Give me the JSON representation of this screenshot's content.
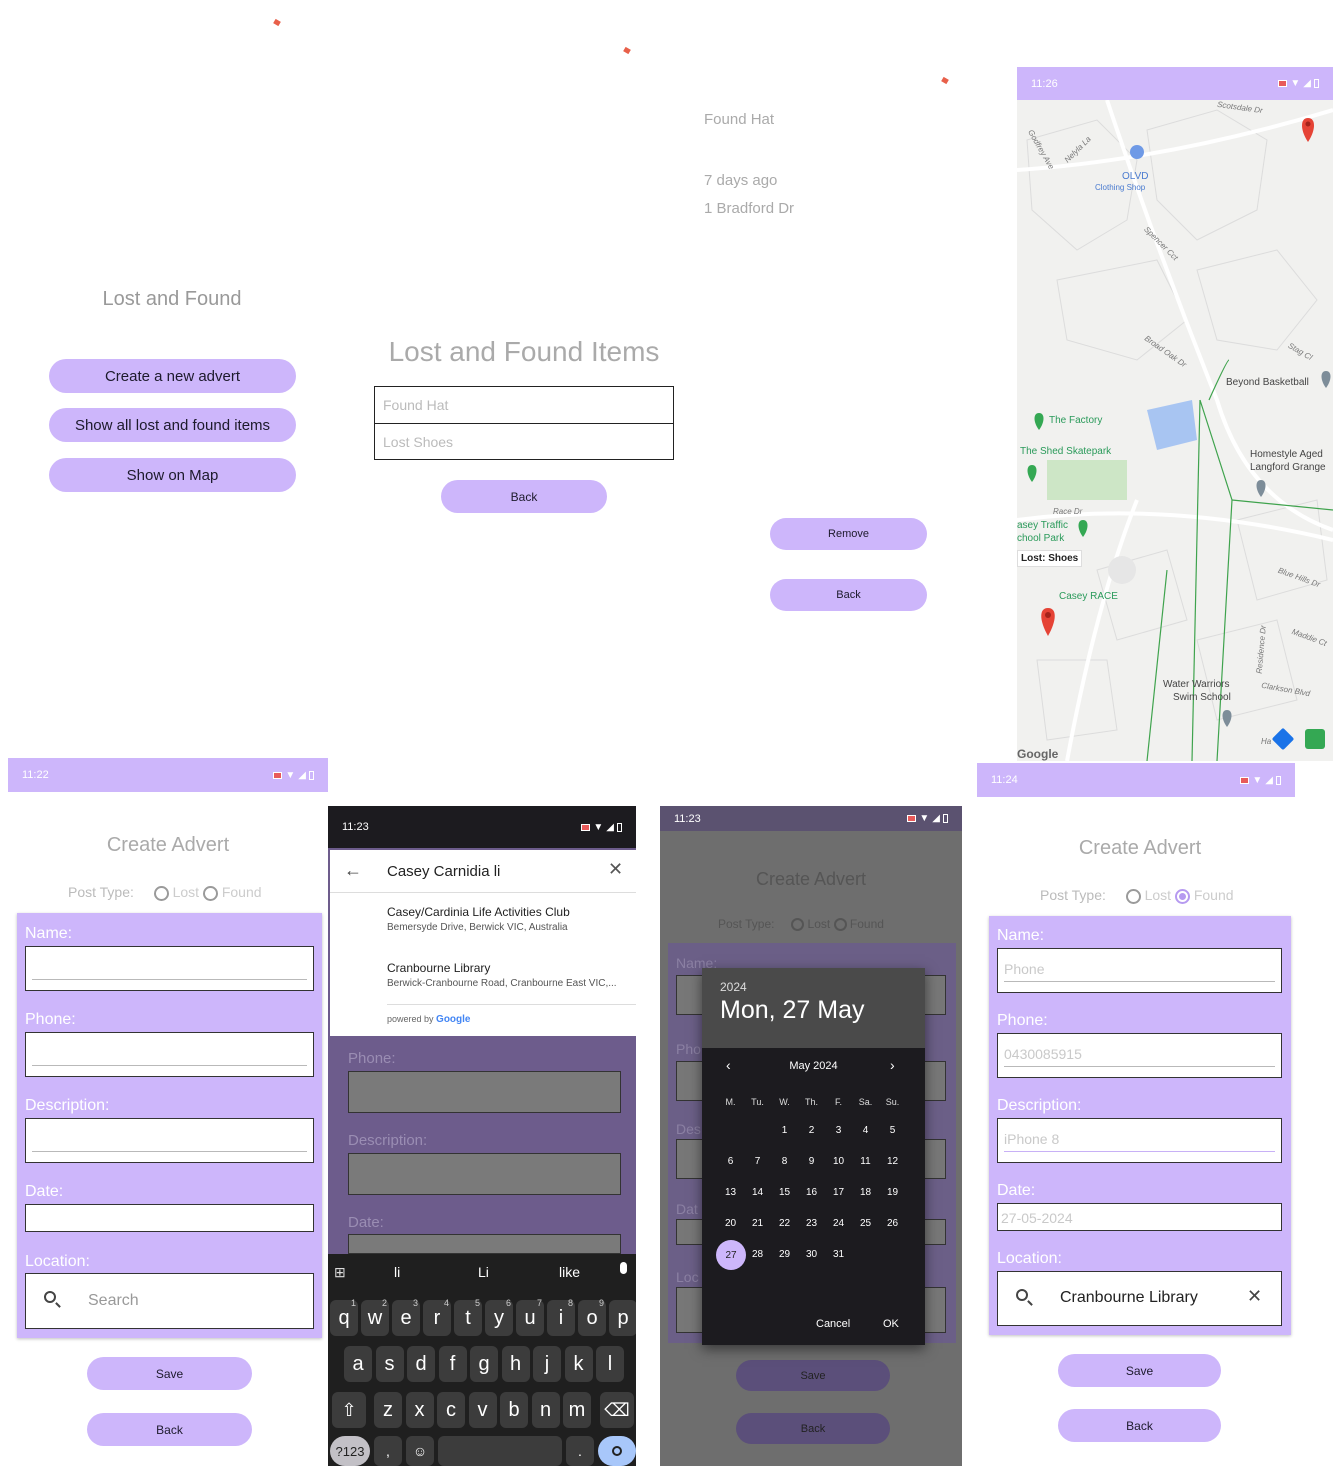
{
  "screen1": {
    "title": "Lost and Found",
    "buttons": [
      "Create a new advert",
      "Show all lost and found items",
      "Show on Map"
    ]
  },
  "screen2": {
    "title": "Lost and Found Items",
    "items": [
      "Found  Hat",
      "Lost  Shoes"
    ],
    "back": "Back"
  },
  "screen3": {
    "title": "Found  Hat",
    "time": "7 days ago",
    "address": "1 Bradford Dr",
    "remove": "Remove",
    "back": "Back"
  },
  "map": {
    "time": "11:26",
    "marker_label": "Lost: Shoes",
    "places": [
      "OLVD",
      "Clothing Shop",
      "Beyond Basketball",
      "The Factory",
      "The Shed Skatepark",
      "Homestyle Aged",
      "Langford Grange",
      "asey Traffic",
      "chool Park",
      "Casey RACE",
      "Water Warriors",
      "Swim School"
    ],
    "streets": [
      "Scotsdale Dr",
      "Godfrey Ave",
      "Nelyla La",
      "Spencer Cct",
      "Broad Oak Dr",
      "Stag Cl",
      "Race Dr",
      "Blue Hills Dr",
      "Maddie Ct",
      "Clarkson Blvd",
      "Residence Dr",
      "Ha"
    ],
    "logo": "Google"
  },
  "create1": {
    "time": "11:22",
    "title": "Create Advert",
    "post_type_label": "Post Type:",
    "option_lost": "Lost",
    "option_found": "Found",
    "name_label": "Name:",
    "phone_label": "Phone:",
    "description_label": "Description:",
    "date_label": "Date:",
    "location_label": "Location:",
    "search_placeholder": "Search",
    "save": "Save",
    "back": "Back"
  },
  "autocomplete": {
    "time": "11:23",
    "query": "Casey Carnidia li",
    "results": [
      {
        "name": "Casey/Cardinia Life Activities Club",
        "address": "Bemersyde Drive, Berwick VIC, Australia"
      },
      {
        "name": "Cranbourne Library",
        "address": "Berwick-Cranbourne Road, Cranbourne East VIC,..."
      }
    ],
    "powered_by": "powered by",
    "google": "Google",
    "phone_label": "Phone:",
    "description_label": "Description:",
    "date_label": "Date:",
    "suggestions": [
      "li",
      "Li",
      "like"
    ],
    "row1": [
      "q",
      "w",
      "e",
      "r",
      "t",
      "y",
      "u",
      "i",
      "o",
      "p"
    ],
    "row1_nums": [
      "1",
      "2",
      "3",
      "4",
      "5",
      "6",
      "7",
      "8",
      "9"
    ],
    "row2": [
      "a",
      "s",
      "d",
      "f",
      "g",
      "h",
      "j",
      "k",
      "l"
    ],
    "row3": [
      "z",
      "x",
      "c",
      "v",
      "b",
      "n",
      "m"
    ],
    "sym_key": "?123",
    "comma": ",",
    "period": "."
  },
  "datepicker": {
    "time": "11:23",
    "title": "Create Advert",
    "post_type_label": "Post Type:",
    "option_lost": "Lost",
    "option_found": "Found",
    "name_label": "Name:",
    "year": "2024",
    "date": "Mon, 27 May",
    "month": "May 2024",
    "weekdays": [
      "M.",
      "Tu.",
      "W.",
      "Th.",
      "F.",
      "Sa.",
      "Su."
    ],
    "selected_day": "27",
    "cancel": "Cancel",
    "ok": "OK",
    "save": "Save",
    "back": "Back",
    "partial_labels": [
      "Pho",
      "Des",
      "Dat",
      "Loc"
    ]
  },
  "create2": {
    "time": "11:24",
    "title": "Create Advert",
    "post_type_label": "Post Type:",
    "option_lost": "Lost",
    "option_found": "Found",
    "name_label": "Name:",
    "name_value": "Phone",
    "phone_label": "Phone:",
    "phone_value": "0430085915",
    "description_label": "Description:",
    "description_value": "iPhone 8",
    "date_label": "Date:",
    "date_value": "27-05-2024",
    "location_label": "Location:",
    "location_value": "Cranbourne Library",
    "save": "Save",
    "back": "Back"
  },
  "colors": {
    "accent": "#cdb6fb",
    "dark": "#1c1b1f",
    "selected_day": "#cdb6fb"
  }
}
